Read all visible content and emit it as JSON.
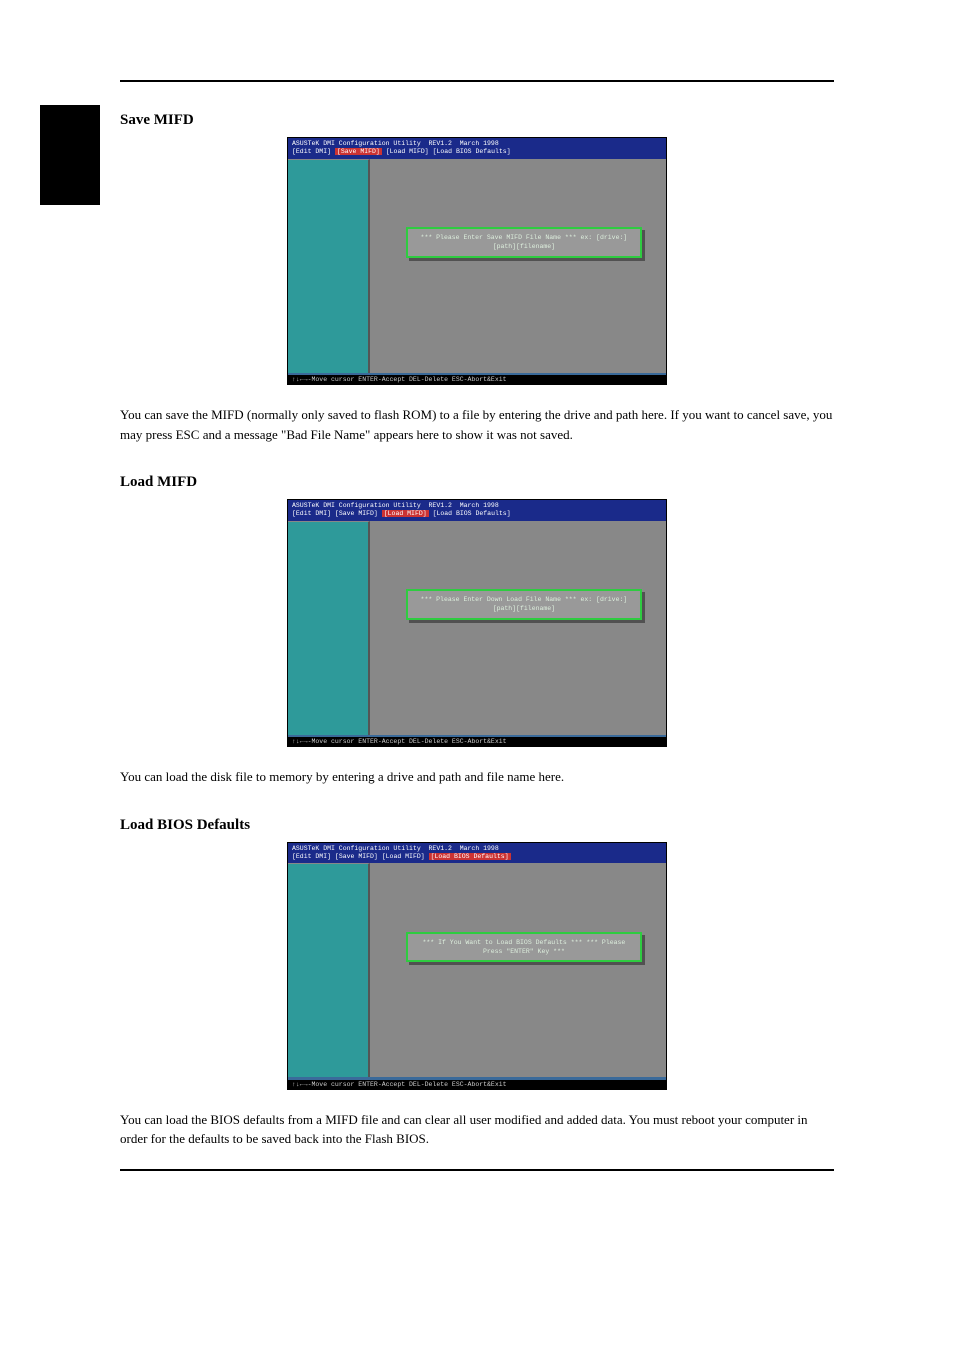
{
  "page_header": "",
  "black_tab": "",
  "sections": {
    "save": {
      "title": "Save MIFD",
      "text": "You can save the MIFD (normally only saved to flash ROM) to a file by entering the drive and path here. If you want to cancel save, you may press ESC and a message \"Bad File Name\" appears here to show it was not saved."
    },
    "load": {
      "title": "Load MIFD",
      "text": "You can load the disk file to memory by entering a drive and path and file name here."
    },
    "defaults": {
      "title": "Load BIOS Defaults",
      "text": "You can load the BIOS defaults from a MIFD file and can clear all user modified and added data. You must reboot your computer in order for the defaults to be saved back into the Flash BIOS."
    }
  },
  "shots": {
    "title_line": "ASUSTeK DMI Configuration Utility  REV1.2  March 1998",
    "menu_items": [
      "[Edit DMI]",
      "[Save MIFD]",
      "[Load MIFD]",
      "[Load BIOS Defaults]"
    ],
    "save_prompt": "*** Please Enter Save MIFD File Name ***\nex: [drive:][path][filename]",
    "load_prompt": "*** Please Enter Down Load File Name ***\nex: [drive:][path][filename]",
    "defaults_prompt": "*** If You Want to Load BIOS Defaults ***\n*** Please Press \"ENTER\" Key ***",
    "footer": "↑↓←→-Move cursor ENTER-Accept DEL-Delete ESC-Abort&Exit"
  },
  "highlight_index": {
    "save": 1,
    "load": 2,
    "defaults": 3
  }
}
